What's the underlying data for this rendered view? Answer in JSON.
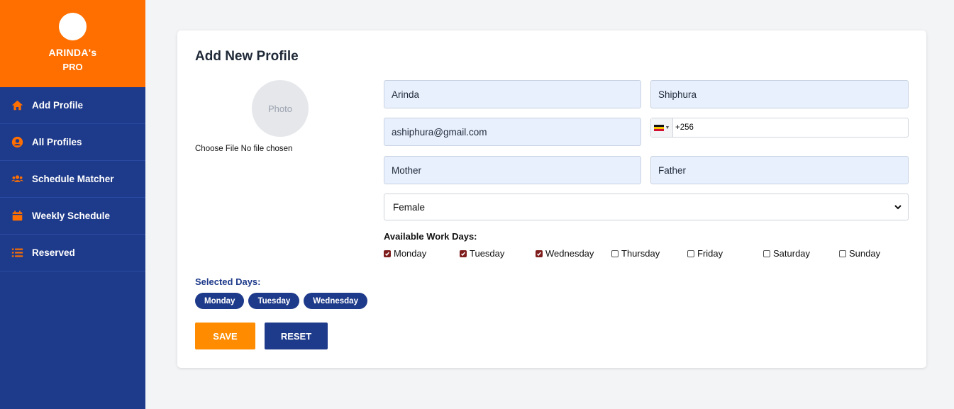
{
  "brand": {
    "name": "ARINDA's",
    "sub": "PRO"
  },
  "colors": {
    "brand_orange": "#ff6f00",
    "navy": "#1e3a8a",
    "save_orange": "#ff8c00",
    "check": "#7f1d1d",
    "field_bg": "#e8f0fe"
  },
  "sidebar": {
    "items": [
      {
        "label": "Add Profile",
        "icon": "home-icon"
      },
      {
        "label": "All Profiles",
        "icon": "user-circle-icon"
      },
      {
        "label": "Schedule Matcher",
        "icon": "users-icon"
      },
      {
        "label": "Weekly Schedule",
        "icon": "calendar-icon"
      },
      {
        "label": "Reserved",
        "icon": "list-icon"
      }
    ]
  },
  "form": {
    "title": "Add New Profile",
    "photo_placeholder": "Photo",
    "file_button": "Choose File",
    "file_status": "No file chosen",
    "first_name": "Arinda",
    "last_name": "Shiphura",
    "email": "ashiphura@gmail.com",
    "phone": "+256",
    "phone_country_icon": "uganda-flag-icon",
    "mother": "Mother",
    "father": "Father",
    "gender": "Female",
    "work_days_label": "Available Work Days:",
    "days": [
      {
        "label": "Monday",
        "checked": true
      },
      {
        "label": "Tuesday",
        "checked": true
      },
      {
        "label": "Wednesday",
        "checked": true
      },
      {
        "label": "Thursday",
        "checked": false
      },
      {
        "label": "Friday",
        "checked": false
      },
      {
        "label": "Saturday",
        "checked": false
      },
      {
        "label": "Sunday",
        "checked": false
      }
    ],
    "selected_label": "Selected Days:",
    "selected_days": [
      "Monday",
      "Tuesday",
      "Wednesday"
    ],
    "save_label": "SAVE",
    "reset_label": "RESET"
  }
}
